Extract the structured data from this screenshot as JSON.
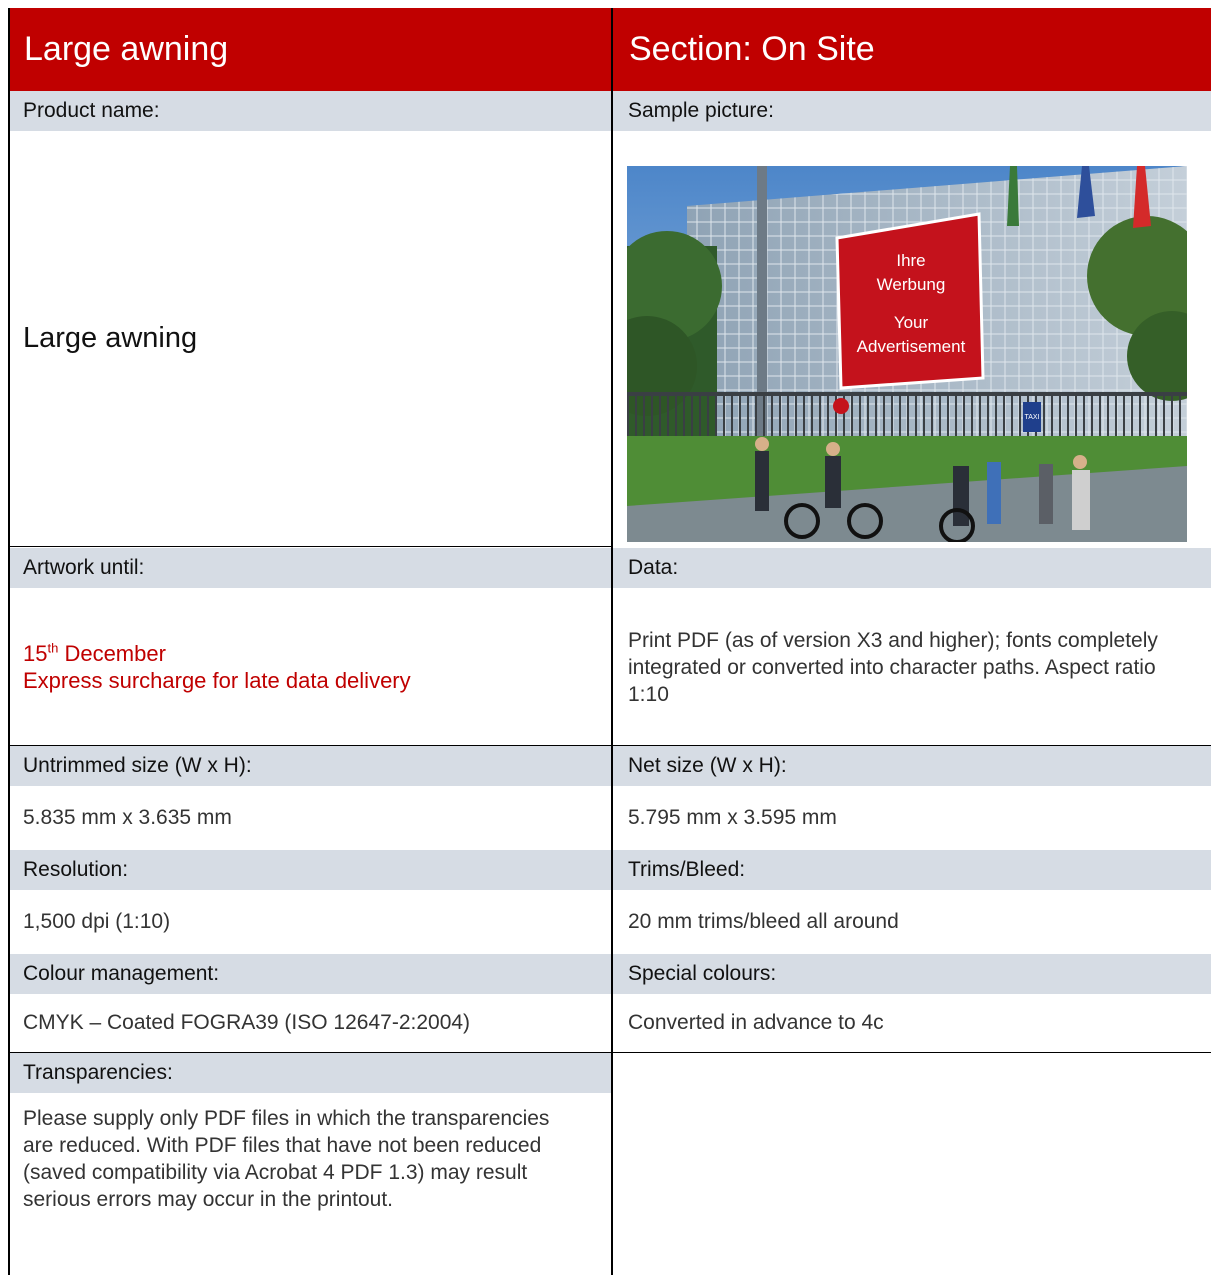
{
  "header": {
    "left_title": "Large awning",
    "right_title": "Section: On Site"
  },
  "rows": {
    "product_label": "Product name:",
    "product_value": "Large awning",
    "sample_label": "Sample picture:",
    "sample_sign": {
      "line1": "Ihre",
      "line2": "Werbung",
      "line3": "Your",
      "line4": "Advertisement",
      "taxi": "TAXI"
    },
    "artwork_label": "Artwork until:",
    "artwork_day": "15",
    "artwork_suffix": "th",
    "artwork_month": " December",
    "artwork_note": "Express surcharge for late data delivery",
    "data_label": "Data:",
    "data_value": "Print PDF (as of version X3 and higher); fonts completely integrated or converted into character paths. Aspect ratio 1:10",
    "untrimmed_label": "Untrimmed size (W x H):",
    "untrimmed_value": "5.835 mm x 3.635 mm",
    "net_label": "Net size (W x H):",
    "net_value": "5.795 mm x 3.595 mm",
    "resolution_label": "Resolution:",
    "resolution_value": "1,500 dpi (1:10)",
    "trims_label": "Trims/Bleed:",
    "trims_value": "20 mm trims/bleed all around",
    "colour_label": "Colour management:",
    "colour_value": "CMYK – Coated FOGRA39 (ISO 12647-2:2004)",
    "special_label": "Special colours:",
    "special_value": "Converted in advance to 4c",
    "transp_label": "Transparencies:",
    "transp_value": "Please supply only PDF files in which the transparencies are reduced. With PDF files that have not been reduced (saved compatibility via Acrobat 4 PDF 1.3) may result serious errors may occur in the printout."
  }
}
